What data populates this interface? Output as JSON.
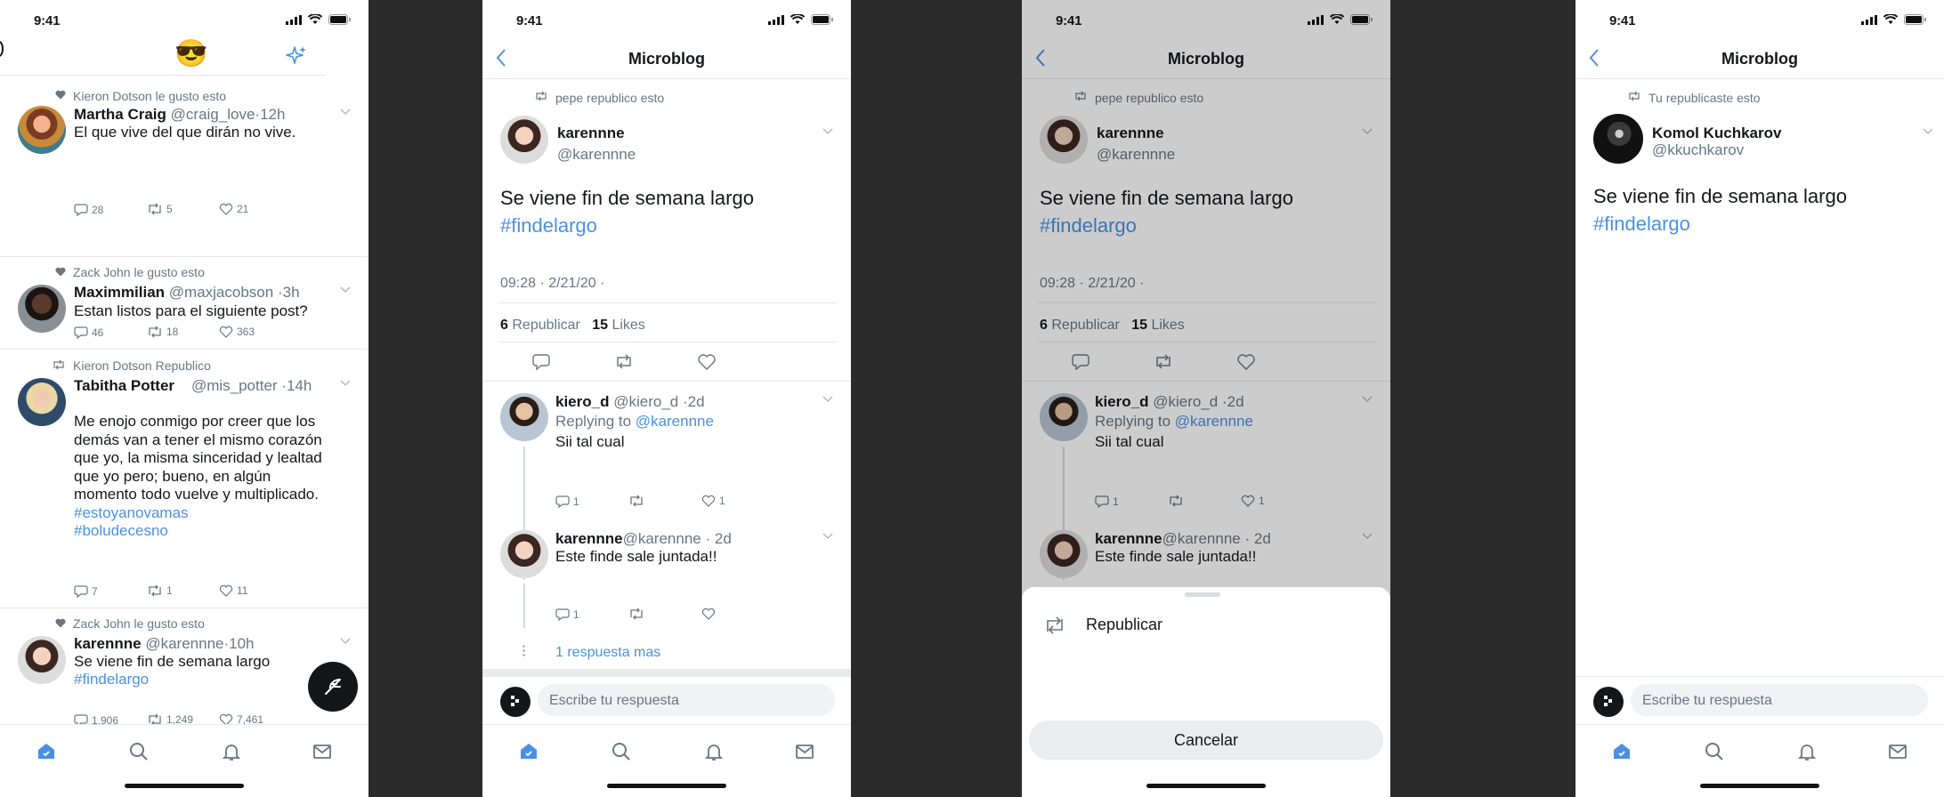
{
  "status": {
    "time": "9:41"
  },
  "colors": {
    "accent": "#4a90e2",
    "text": "#141619",
    "secondary": "#687684",
    "divider": "#e4e6e8"
  },
  "icons": [
    "signal-icon",
    "wifi-icon",
    "battery-icon",
    "back-icon",
    "sparkle-icon",
    "home-icon",
    "search-icon",
    "bell-icon",
    "mail-icon",
    "reply-icon",
    "retweet-icon",
    "heart-icon",
    "chevron-down-icon",
    "compose-icon"
  ],
  "feed": {
    "header_emoji": "😎",
    "tweets": [
      {
        "context": "Kieron Dotson  le gusto esto",
        "name": "Martha Craig",
        "handle": "@craig_love",
        "time": "·12h",
        "text": "El que vive del que dirán no vive.",
        "replies": "28",
        "retweets": "5",
        "likes": "21"
      },
      {
        "context": "Zack John le gusto esto",
        "name": "Maximmilian",
        "handle": "@maxjacobson",
        "time": "·3h",
        "text": "Estan listos para el siguiente post?",
        "replies": "46",
        "retweets": "18",
        "likes": "363"
      },
      {
        "context": "Kieron Dotson Republico",
        "name": "Tabitha Potter",
        "handle": "@mis_potter",
        "time": "·14h",
        "text_lines": [
          "Me enojo conmigo por creer que los",
          "demás van a tener el mismo corazón",
          "que yo, la misma sinceridad y lealtad",
          "que yo pero; bueno, en algún",
          "momento todo vuelve y multiplicado."
        ],
        "tags": [
          "#estoyanovamas",
          "#boludecesno"
        ],
        "replies": "7",
        "retweets": "1",
        "likes": "11"
      },
      {
        "context": "Zack John le gusto esto",
        "name": "karennne",
        "handle": "@karennne",
        "time": "·10h",
        "text": "Se viene fin de semana largo",
        "tag": "#findelargo",
        "replies": "1,906",
        "retweets": "1,249",
        "likes": "7,461"
      }
    ]
  },
  "detail": {
    "nav_title": "Microblog",
    "context": "pepe republico esto",
    "name": "karennne",
    "handle": "@karennne",
    "text": "Se viene fin de semana largo",
    "tag": "#findelargo",
    "datetime": "09:28 · 2/21/20 ·",
    "rt_count": "6",
    "rt_label": "Republicar",
    "like_count": "15",
    "like_label": "Likes",
    "replies": [
      {
        "name": "kiero_d",
        "handle": "@kiero_d",
        "time": "·2d",
        "replying_label": "Replying to",
        "replying_to": "@karennne",
        "text": "Sii tal cual",
        "replies": "1",
        "likes": "1"
      },
      {
        "name": "karennne",
        "handle": "@karennne",
        "time": "· 2d",
        "text": "Este finde sale juntada!!",
        "replies": "1"
      }
    ],
    "more_replies": "1 respuesta mas",
    "reply_placeholder": "Escribe tu respuesta"
  },
  "sheet": {
    "retweet_option": "Republicar",
    "cancel": "Cancelar"
  },
  "own": {
    "context": "Tu republicaste esto",
    "name": "Komol Kuchkarov",
    "handle": "@kkuchkarov",
    "text": "Se viene fin de semana largo",
    "tag": "#findelargo"
  }
}
